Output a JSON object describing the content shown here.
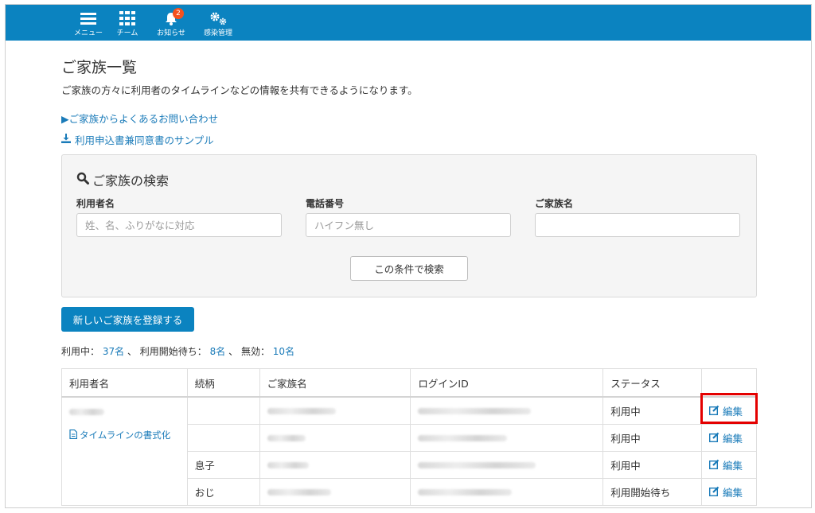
{
  "nav": {
    "items": [
      {
        "label": "メニュー",
        "icon": "menu-icon"
      },
      {
        "label": "チーム",
        "icon": "grid-icon"
      },
      {
        "label": "お知らせ",
        "icon": "bell-icon",
        "badge": "2"
      },
      {
        "label": "感染管理",
        "icon": "gears-icon"
      }
    ]
  },
  "page": {
    "title": "ご家族一覧",
    "description": "ご家族の方々に利用者のタイムラインなどの情報を共有できるようになります。",
    "faq_link": "▶ご家族からよくあるお問い合わせ",
    "download_link": "利用申込書兼同意書のサンプル"
  },
  "search": {
    "title": "ご家族の検索",
    "fields": [
      {
        "label": "利用者名",
        "placeholder": "姓、名、ふりがなに対応"
      },
      {
        "label": "電話番号",
        "placeholder": "ハイフン無し"
      },
      {
        "label": "ご家族名",
        "placeholder": ""
      }
    ],
    "button": "この条件で検索"
  },
  "register_button": "新しいご家族を登録する",
  "counts": {
    "active_label": "利用中：",
    "active": "37名",
    "sep1": "、",
    "pending_label": "利用開始待ち：",
    "pending": "8名",
    "sep2": "、",
    "inactive_label": "無効：",
    "inactive": "10名"
  },
  "table": {
    "headers": [
      "利用者名",
      "続柄",
      "ご家族名",
      "ログインID",
      "ステータス",
      ""
    ],
    "timeline_link": "タイムラインの書式化",
    "edit_label": "編集",
    "rows": [
      {
        "relation": "",
        "status": "利用中"
      },
      {
        "relation": "",
        "status": "利用中"
      },
      {
        "relation": "息子",
        "status": "利用中"
      },
      {
        "relation": "おじ",
        "status": "利用開始待ち"
      }
    ]
  },
  "colors": {
    "header": "#0b83c0",
    "link": "#1a7bb9",
    "highlight": "#e40000",
    "badge": "#f4511e"
  }
}
